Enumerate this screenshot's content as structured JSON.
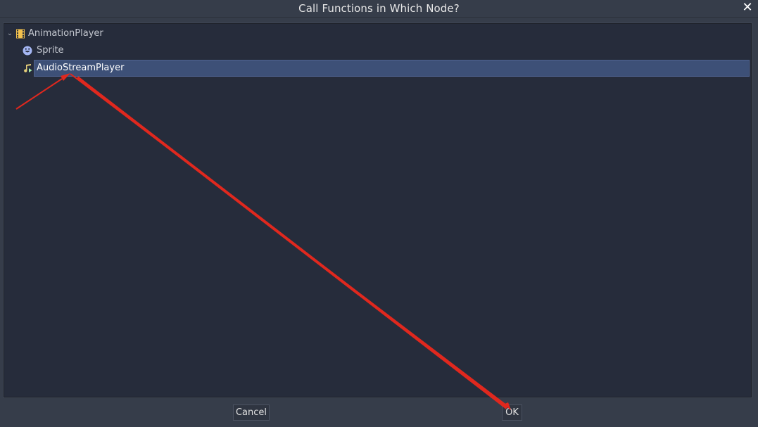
{
  "dialog": {
    "title": "Call Functions in Which Node?",
    "close_icon": "close-icon"
  },
  "tree": {
    "items": [
      {
        "label": "AnimationPlayer",
        "icon": "animation-player-icon",
        "expanded": true,
        "selected": false
      },
      {
        "label": "Sprite",
        "icon": "sprite-icon",
        "selected": false
      },
      {
        "label": "AudioStreamPlayer",
        "icon": "audio-stream-player-icon",
        "selected": true
      }
    ]
  },
  "buttons": {
    "cancel_label": "Cancel",
    "ok_label": "OK"
  },
  "colors": {
    "background": "#363d4a",
    "tree_background": "#262c3b",
    "selection": "#3d5077",
    "annotation_arrow": "#e0281e"
  }
}
